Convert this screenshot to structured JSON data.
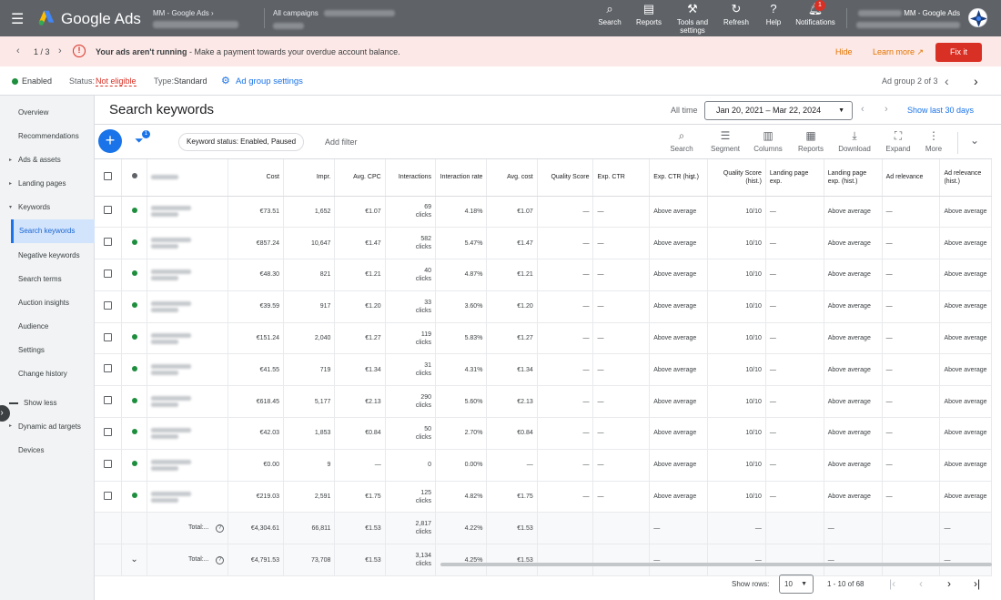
{
  "topbar": {
    "brand": "Google Ads",
    "account_label": "MM - Google Ads",
    "campaign_label": "All campaigns",
    "tools": [
      {
        "icon": "search-icon",
        "label": "Search"
      },
      {
        "icon": "reports-icon",
        "label": "Reports"
      },
      {
        "icon": "wrench-icon",
        "label": "Tools and settings"
      },
      {
        "icon": "refresh-icon",
        "label": "Refresh"
      },
      {
        "icon": "help-icon",
        "label": "Help"
      },
      {
        "icon": "bell-icon",
        "label": "Notifications"
      }
    ],
    "notification_count": "1",
    "user_account": "MM - Google Ads"
  },
  "alert": {
    "pager": "1 / 3",
    "title": "Your ads aren't running",
    "message": " - Make a payment towards your overdue account balance.",
    "hide": "Hide",
    "learn_more": "Learn more",
    "fix": "Fix it"
  },
  "status": {
    "enabled": "Enabled",
    "status_label": "Status:",
    "status_value": "Not eligible",
    "type_label": "Type:",
    "type_value": "Standard",
    "settings": "Ad group settings",
    "adgroup_pos": "Ad group 2 of 3"
  },
  "sidebar": {
    "items": [
      "Overview",
      "Recommendations",
      "Ads & assets",
      "Landing pages",
      "Keywords",
      "Search keywords",
      "Negative keywords",
      "Search terms",
      "Auction insights",
      "Audience",
      "Settings",
      "Change history",
      "Show less",
      "Dynamic ad targets",
      "Devices"
    ]
  },
  "main": {
    "title": "Search keywords",
    "all_time": "All time",
    "date_range": "Jan 20, 2021 – Mar 22, 2024",
    "show_last": "Show last 30 days",
    "filter_count": "1",
    "chip": "Keyword status: Enabled, Paused",
    "add_filter": "Add filter",
    "tools": [
      "Search",
      "Segment",
      "Columns",
      "Reports",
      "Download",
      "Expand",
      "More"
    ]
  },
  "table": {
    "headers": [
      "Keyword",
      "Cost",
      "Impr.",
      "Avg. CPC",
      "Interactions",
      "Interaction rate",
      "Avg. cost",
      "Quality Score",
      "Exp. CTR",
      "Exp. CTR (hist.)",
      "Quality Score (hist.)",
      "Landing page exp.",
      "Landing page exp. (hist.)",
      "Ad relevance",
      "Ad relevance (hist.)",
      "Clicks"
    ],
    "rows": [
      {
        "cost": "€73.51",
        "impr": "1,652",
        "cpc": "€1.07",
        "inter": "69",
        "unit": "clicks",
        "rate": "4.18%",
        "avg": "€1.07",
        "qs": "—",
        "ctr": "—",
        "ctrh": "Above average",
        "qsh": "10/10",
        "lp": "—",
        "lph": "Above average",
        "ar": "—",
        "arh": "Above average",
        "clicks": "69"
      },
      {
        "cost": "€857.24",
        "impr": "10,647",
        "cpc": "€1.47",
        "inter": "582",
        "unit": "clicks",
        "rate": "5.47%",
        "avg": "€1.47",
        "qs": "—",
        "ctr": "—",
        "ctrh": "Above average",
        "qsh": "10/10",
        "lp": "—",
        "lph": "Above average",
        "ar": "—",
        "arh": "Above average",
        "clicks": "582"
      },
      {
        "cost": "€48.30",
        "impr": "821",
        "cpc": "€1.21",
        "inter": "40",
        "unit": "clicks",
        "rate": "4.87%",
        "avg": "€1.21",
        "qs": "—",
        "ctr": "—",
        "ctrh": "Above average",
        "qsh": "10/10",
        "lp": "—",
        "lph": "Above average",
        "ar": "—",
        "arh": "Above average",
        "clicks": "40"
      },
      {
        "cost": "€39.59",
        "impr": "917",
        "cpc": "€1.20",
        "inter": "33",
        "unit": "clicks",
        "rate": "3.60%",
        "avg": "€1.20",
        "qs": "—",
        "ctr": "—",
        "ctrh": "Above average",
        "qsh": "10/10",
        "lp": "—",
        "lph": "Above average",
        "ar": "—",
        "arh": "Above average",
        "clicks": "33"
      },
      {
        "cost": "€151.24",
        "impr": "2,040",
        "cpc": "€1.27",
        "inter": "119",
        "unit": "clicks",
        "rate": "5.83%",
        "avg": "€1.27",
        "qs": "—",
        "ctr": "—",
        "ctrh": "Above average",
        "qsh": "10/10",
        "lp": "—",
        "lph": "Above average",
        "ar": "—",
        "arh": "Above average",
        "clicks": "119"
      },
      {
        "cost": "€41.55",
        "impr": "719",
        "cpc": "€1.34",
        "inter": "31",
        "unit": "clicks",
        "rate": "4.31%",
        "avg": "€1.34",
        "qs": "—",
        "ctr": "—",
        "ctrh": "Above average",
        "qsh": "10/10",
        "lp": "—",
        "lph": "Above average",
        "ar": "—",
        "arh": "Above average",
        "clicks": "31"
      },
      {
        "cost": "€618.45",
        "impr": "5,177",
        "cpc": "€2.13",
        "inter": "290",
        "unit": "clicks",
        "rate": "5.60%",
        "avg": "€2.13",
        "qs": "—",
        "ctr": "—",
        "ctrh": "Above average",
        "qsh": "10/10",
        "lp": "—",
        "lph": "Above average",
        "ar": "—",
        "arh": "Above average",
        "clicks": "290"
      },
      {
        "cost": "€42.03",
        "impr": "1,853",
        "cpc": "€0.84",
        "inter": "50",
        "unit": "clicks",
        "rate": "2.70%",
        "avg": "€0.84",
        "qs": "—",
        "ctr": "—",
        "ctrh": "Above average",
        "qsh": "10/10",
        "lp": "—",
        "lph": "Above average",
        "ar": "—",
        "arh": "Above average",
        "clicks": "50"
      },
      {
        "cost": "€0.00",
        "impr": "9",
        "cpc": "—",
        "inter": "0",
        "unit": "",
        "rate": "0.00%",
        "avg": "—",
        "qs": "—",
        "ctr": "—",
        "ctrh": "Above average",
        "qsh": "10/10",
        "lp": "—",
        "lph": "Above average",
        "ar": "—",
        "arh": "Above average",
        "clicks": "0"
      },
      {
        "cost": "€219.03",
        "impr": "2,591",
        "cpc": "€1.75",
        "inter": "125",
        "unit": "clicks",
        "rate": "4.82%",
        "avg": "€1.75",
        "qs": "—",
        "ctr": "—",
        "ctrh": "Above average",
        "qsh": "10/10",
        "lp": "—",
        "lph": "Above average",
        "ar": "—",
        "arh": "Above average",
        "clicks": "125"
      }
    ],
    "totals": [
      {
        "label": "Total:...",
        "cost": "€4,304.61",
        "impr": "66,811",
        "cpc": "€1.53",
        "inter": "2,817",
        "unit": "clicks",
        "rate": "4.22%",
        "avg": "€1.53",
        "ctrh": "—",
        "qsh": "—",
        "lph": "—",
        "arh": "—",
        "clicks": "2,817"
      },
      {
        "label": "Total:...",
        "cost": "€4,791.53",
        "impr": "73,708",
        "cpc": "€1.53",
        "inter": "3,134",
        "unit": "clicks",
        "rate": "4.25%",
        "avg": "€1.53",
        "ctrh": "—",
        "qsh": "—",
        "lph": "—",
        "arh": "—",
        "clicks": "3,134"
      }
    ]
  },
  "footer": {
    "show_rows": "Show rows:",
    "rows_value": "10",
    "range": "1 - 10 of 68"
  }
}
